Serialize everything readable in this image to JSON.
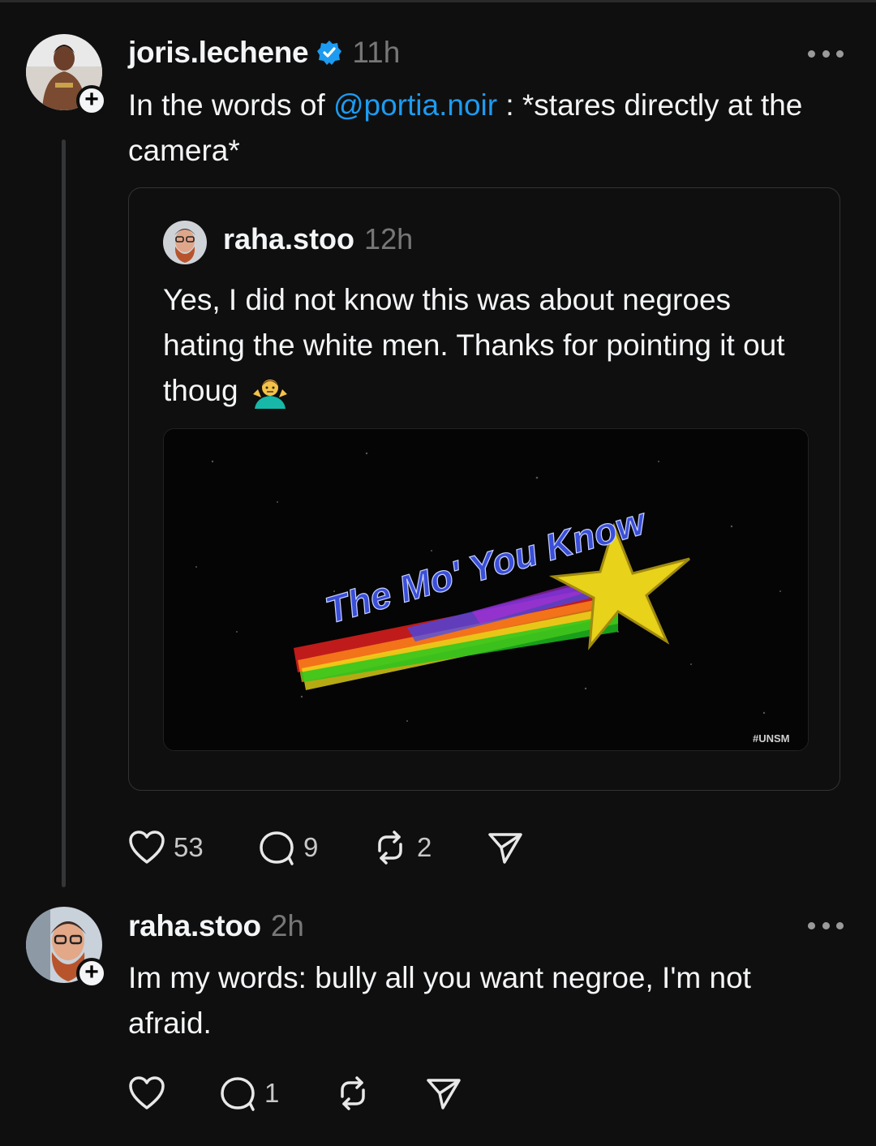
{
  "post1": {
    "username": "joris.lechene",
    "time": "11h",
    "text_pre": "In the words of ",
    "mention": "@portia.noir",
    "text_post": " : *stares directly at the camera*",
    "quote": {
      "username": "raha.stoo",
      "time": "12h",
      "text": "Yes, I did not know this was about negroes hating the white men. Thanks for pointing it out thoug",
      "emoji": "person-shrugging",
      "media": {
        "title": "The Mo' You Know",
        "watermark": "#UNSM"
      }
    },
    "actions": {
      "likes": "53",
      "replies": "9",
      "reposts": "2"
    }
  },
  "post2": {
    "username": "raha.stoo",
    "time": "2h",
    "text": "Im my words: bully all you want negroe, I'm not afraid.",
    "actions": {
      "replies": "1"
    }
  },
  "icons": {
    "verified": "verified-badge-icon",
    "like": "heart-icon",
    "reply": "comment-icon",
    "repost": "repost-icon",
    "share": "send-icon",
    "more": "more-icon",
    "follow": "plus-icon"
  },
  "colors": {
    "background": "#0f0f0f",
    "mention": "#1d9bf0",
    "verified": "#1d9bf0",
    "muted": "#777777"
  }
}
